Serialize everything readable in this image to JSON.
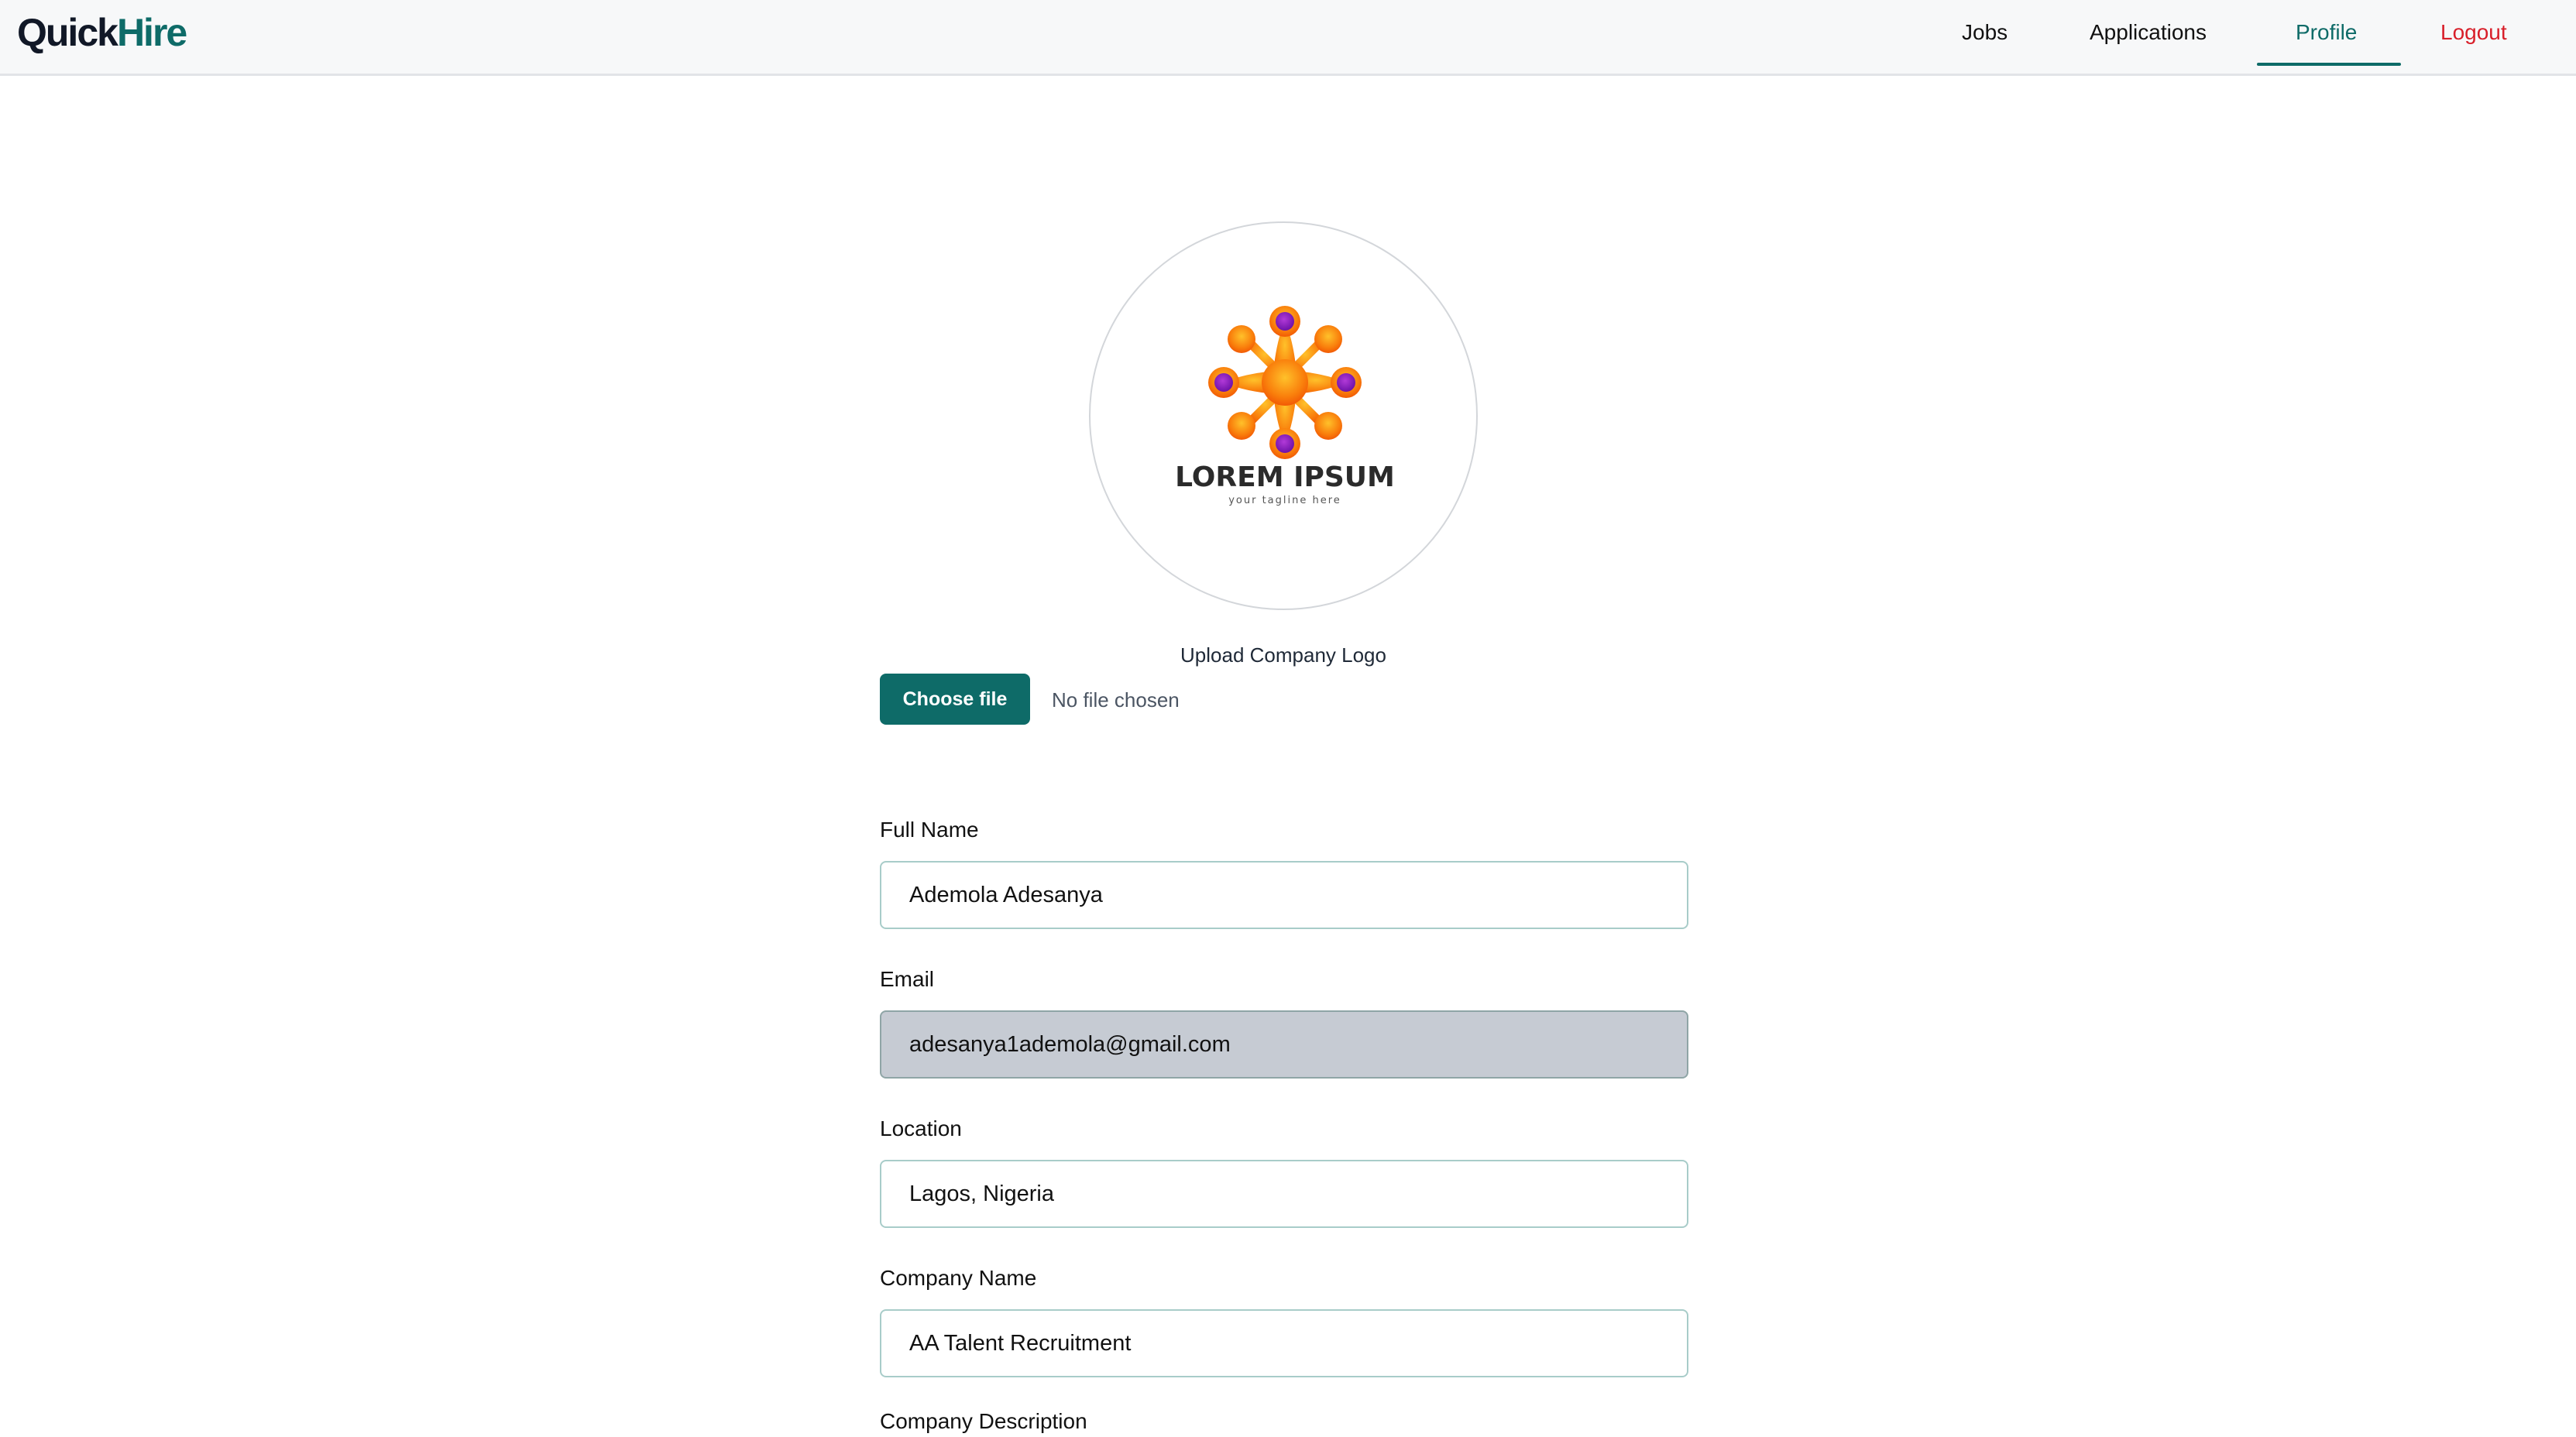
{
  "header": {
    "brand_part1": "Quick",
    "brand_part2": "Hire",
    "nav": {
      "jobs": "Jobs",
      "applications": "Applications",
      "profile": "Profile",
      "logout": "Logout"
    },
    "active_tab": "Profile"
  },
  "logo": {
    "title": "LOREM IPSUM",
    "tagline": "your tagline here"
  },
  "upload": {
    "label": "Upload Company Logo",
    "button": "Choose file",
    "status": "No file chosen"
  },
  "form": {
    "full_name": {
      "label": "Full Name",
      "value": "Ademola Adesanya"
    },
    "email": {
      "label": "Email",
      "value": "adesanya1ademola@gmail.com",
      "disabled": true
    },
    "location": {
      "label": "Location",
      "value": "Lagos, Nigeria"
    },
    "company_name": {
      "label": "Company Name",
      "value": "AA Talent Recruitment"
    },
    "company_description": {
      "label": "Company Description"
    }
  },
  "colors": {
    "brand_teal": "#0e6b68",
    "logout_red": "#d81f2a",
    "disabled_field": "#c6cbd3",
    "logo_orange": "#f97d0b",
    "logo_purple": "#8b1fbf"
  }
}
